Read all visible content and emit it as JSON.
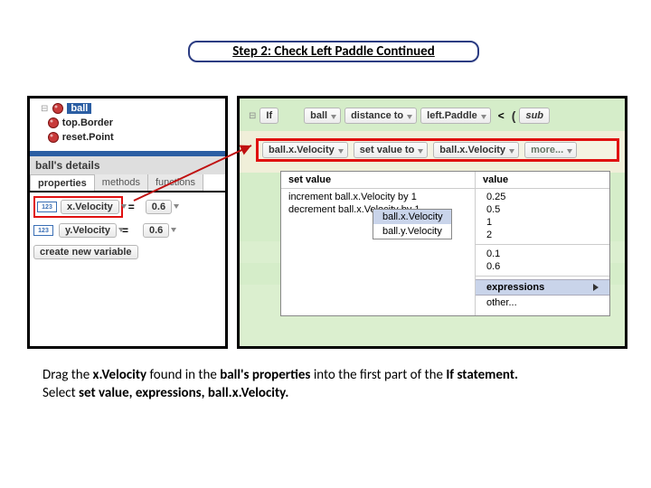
{
  "title": "Step 2: Check Left Paddle Continued",
  "tree": {
    "items": [
      {
        "label": "ball",
        "selected": true
      },
      {
        "label": "top.Border",
        "selected": false
      },
      {
        "label": "reset.Point",
        "selected": false
      }
    ]
  },
  "details": {
    "heading": "ball's details",
    "tabs": [
      "properties",
      "methods",
      "functions"
    ],
    "active_tab": "properties",
    "props": [
      {
        "name": "x.Velocity",
        "eq": "=",
        "value": "0.6"
      },
      {
        "name": "y.Velocity",
        "eq": "=",
        "value": "0.6"
      }
    ],
    "new_var": "create new variable"
  },
  "code": {
    "if_label": "If",
    "if_tokens": [
      "ball",
      "distance to",
      "left.Paddle",
      "<",
      "sub"
    ],
    "red_row": [
      "ball.x.Velocity",
      "set value to",
      "ball.x.Velocity",
      "more..."
    ]
  },
  "menu": {
    "col1_head": "set value",
    "col2_head": "value",
    "col1_items": [
      "increment ball.x.Velocity by 1",
      "decrement ball.x.Velocity by 1"
    ],
    "value_items_a": [
      "0.25",
      "0.5",
      "1",
      "2"
    ],
    "value_items_b": [
      "0.1",
      "0.6"
    ],
    "expressions_label": "expressions",
    "other_label": "other..."
  },
  "submenu": {
    "items": [
      "ball.x.Velocity",
      "ball.y.Velocity"
    ]
  },
  "footer": {
    "p1a": "Drag the ",
    "p1b": "x.Velocity ",
    "p1c": "found in the ",
    "p1d": "ball's properties ",
    "p1e": "into the first part of the ",
    "p1f": "If statement.",
    "p2a": "Select ",
    "p2b": "set value, expressions, ball.x.Velocity."
  },
  "icons": {
    "ball_fill": "#c83a3a"
  }
}
